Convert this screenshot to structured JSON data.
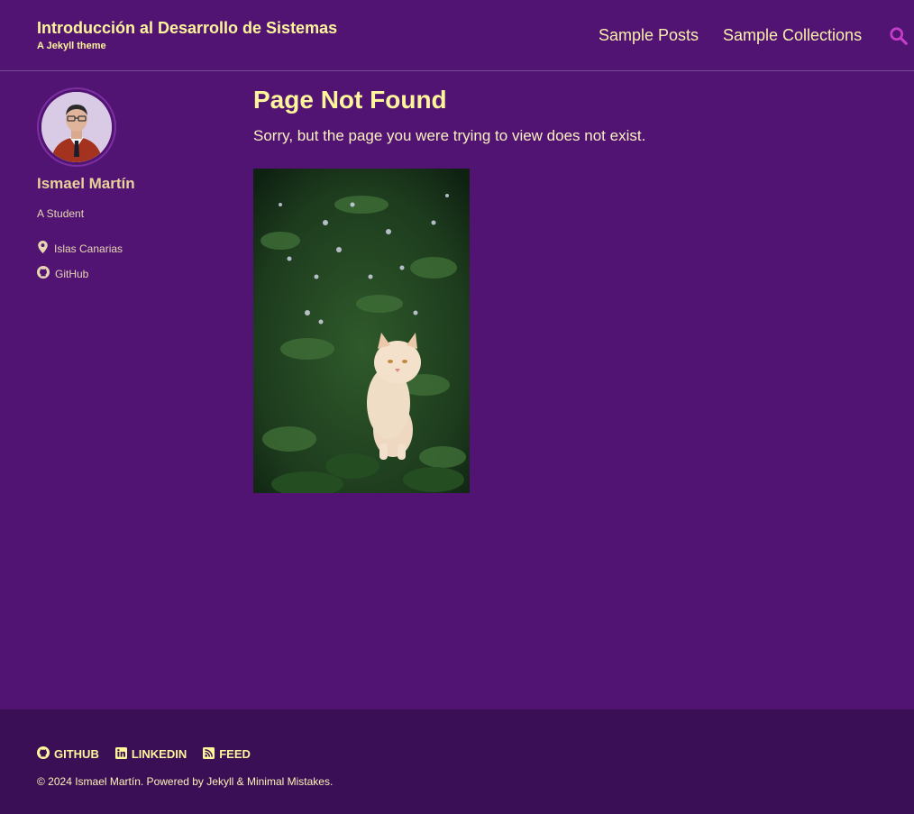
{
  "header": {
    "site_title": "Introducción al Desarrollo de Sistemas",
    "site_subtitle": "A Jekyll theme",
    "nav": [
      {
        "label": "Sample Posts"
      },
      {
        "label": "Sample Collections"
      }
    ],
    "search_icon": "search-icon"
  },
  "sidebar": {
    "author_name": "Ismael Martín",
    "bio": "A Student",
    "links": [
      {
        "icon": "map-marker-icon",
        "label": "Islas Canarias"
      },
      {
        "icon": "github-icon",
        "label": "GitHub"
      }
    ]
  },
  "main": {
    "title": "Page Not Found",
    "lead": "Sorry, but the page you were trying to view does not exist."
  },
  "footer": {
    "links": [
      {
        "icon": "github-icon",
        "label": "GITHUB"
      },
      {
        "icon": "linkedin-icon",
        "label": "LINKEDIN"
      },
      {
        "icon": "rss-icon",
        "label": "FEED"
      }
    ],
    "copyright_prefix": "© 2024 Ismael Martín. Powered by ",
    "jekyll": "Jekyll",
    "amp": " & ",
    "theme": "Minimal Mistakes",
    "period": "."
  },
  "colors": {
    "background": "#521473",
    "footer_background": "#3b0f55",
    "title_yellow": "#fff59a",
    "search_icon": "#c33dc7"
  }
}
